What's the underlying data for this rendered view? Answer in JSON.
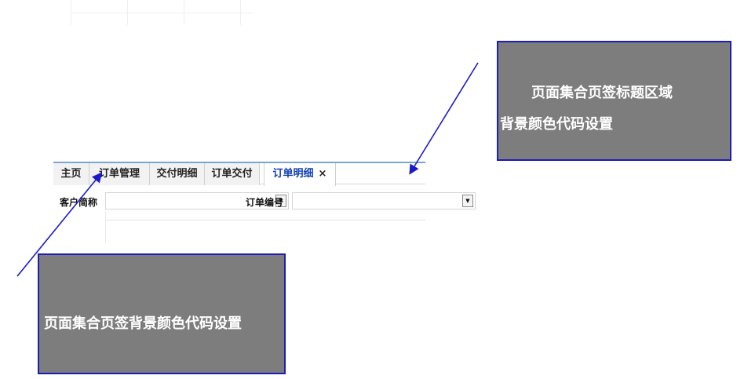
{
  "tabs": [
    {
      "label": "主页"
    },
    {
      "label": "订单管理"
    },
    {
      "label": "交付明细"
    },
    {
      "label": "订单交付"
    },
    {
      "label": "订单明细",
      "active": true,
      "close": "×"
    }
  ],
  "form": {
    "customer_label": "客户简称",
    "order_label": "订单编号",
    "dropdown_glyph": "▼"
  },
  "annotations": {
    "top_right_line1": "页面集合页签标题区域",
    "top_right_line2": "背景颜色代码设置",
    "bottom_left": "页面集合页签背景颜色代码设置"
  },
  "colors": {
    "note_bg": "#7d7d7d",
    "note_border": "#1d1db8",
    "arrow": "#1a1acd",
    "active_tab_text": "#0e3fb5",
    "tabbar_top": "#7aa7cf"
  }
}
